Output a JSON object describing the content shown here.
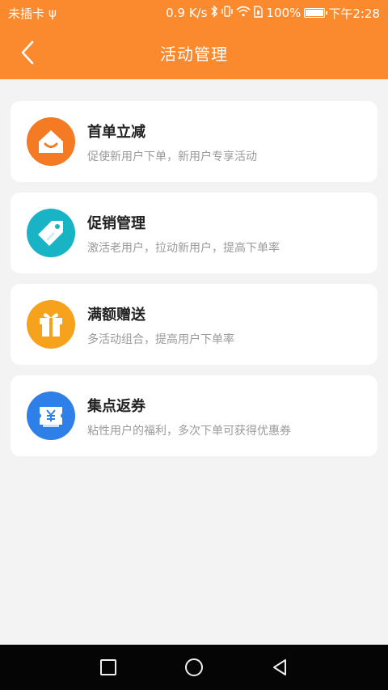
{
  "status_bar": {
    "carrier": "未插卡",
    "usb": "ψ",
    "speed": "0.9 K/s",
    "battery": "100%",
    "time": "下午2:28"
  },
  "header": {
    "title": "活动管理"
  },
  "activities": [
    {
      "title": "首单立减",
      "subtitle": "促使新用户下单，新用户专享活动",
      "icon": "house-icon",
      "color": "#f47a24"
    },
    {
      "title": "促销管理",
      "subtitle": "激活老用户，拉动新用户，提高下单率",
      "icon": "tag-icon",
      "color": "#18b3c4"
    },
    {
      "title": "满额赠送",
      "subtitle": "多活动组合，提高用户下单率",
      "icon": "gift-icon",
      "color": "#f7a21c"
    },
    {
      "title": "集点返券",
      "subtitle": "粘性用户的福利，多次下单可获得优惠券",
      "icon": "coupon-icon",
      "color": "#2e7fe8"
    }
  ],
  "theme": {
    "accent": "#fb8a2e",
    "background": "#f3f3f3"
  }
}
